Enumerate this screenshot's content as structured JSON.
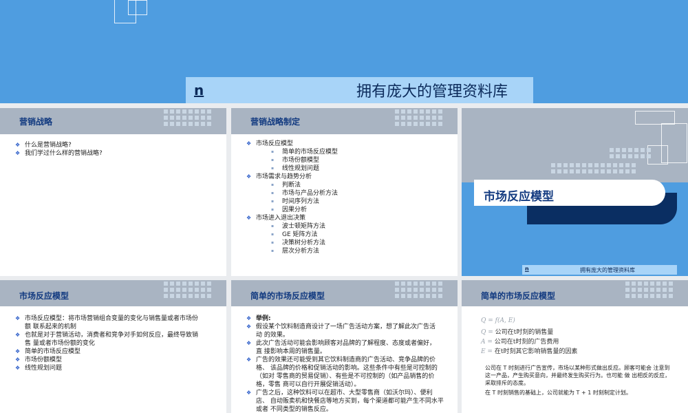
{
  "banner": {
    "marker": "n",
    "title": "拥有庞大的管理资料库"
  },
  "slide1": {
    "title": "营销战略",
    "items": [
      {
        "bullet": "❖",
        "text": "什么是营销战略?"
      },
      {
        "bullet": "❖",
        "text": "我们学过什么样的营销战略?"
      }
    ]
  },
  "slide2": {
    "title": "营销战略制定",
    "items": [
      {
        "bullet": "❖",
        "text": "市场反应模型"
      },
      {
        "bullet": "▪",
        "text": "简单的市场反应模型"
      },
      {
        "bullet": "▪",
        "text": "市场份额模型"
      },
      {
        "bullet": "▪",
        "text": "线性规划问题"
      },
      {
        "bullet": "❖",
        "text": "市场需求与趋势分析"
      },
      {
        "bullet": "▪",
        "text": "判断法"
      },
      {
        "bullet": "▪",
        "text": "市场与产品分析方法"
      },
      {
        "bullet": "▪",
        "text": "时间序列方法"
      },
      {
        "bullet": "▪",
        "text": "因果分析"
      },
      {
        "bullet": "❖",
        "text": "市场进入退出决策"
      },
      {
        "bullet": "▪",
        "text": "波士顿矩阵方法"
      },
      {
        "bullet": "▪",
        "text": "GE 矩阵方法"
      },
      {
        "bullet": "▪",
        "text": "决策树分析方法"
      },
      {
        "bullet": "▪",
        "text": "层次分析方法"
      }
    ]
  },
  "slide3": {
    "title": "市场反应模型",
    "footer_marker": "n",
    "footer_text": "拥有庞大的管理资料库"
  },
  "slide4": {
    "title": "市场反应模型",
    "items": [
      {
        "bullet": "❖",
        "text": "市场反应模型：将市场营销组合变量的变化与销售量或者市场份"
      },
      {
        "bullet": "",
        "text": "额 联系起来的机制"
      },
      {
        "bullet": "❖",
        "text": "也就是对于营销活动，消费者和竞争对手如何反应，最终导致销"
      },
      {
        "bullet": "",
        "text": "售 量或者市场份额的变化"
      },
      {
        "bullet": "❖",
        "text": "简单的市场反应模型"
      },
      {
        "bullet": "❖",
        "text": "市场份额模型"
      },
      {
        "bullet": "❖",
        "text": "线性规划问题"
      }
    ]
  },
  "slide5": {
    "title": "简单的市场反应模型",
    "items": [
      {
        "bullet": "❖",
        "text": "举例:"
      },
      {
        "bullet": "❖",
        "text": "假设某个饮料制造商设计了一场广告活动方案，想了解此次广告活"
      },
      {
        "bullet": "",
        "text": "动 的效果。"
      },
      {
        "bullet": "❖",
        "text": "此次广告活动可能会影响顾客对品牌的了解程度、态度或者偏好，"
      },
      {
        "bullet": "",
        "text": "直 接影响本周的销售量。"
      },
      {
        "bullet": "❖",
        "text": "广告的效果还可能受到其它饮料制造商的广告活动、竞争品牌的价"
      },
      {
        "bullet": "",
        "text": "格、 该品牌的价格和促销活动的影响。这些条件中有些是可控制的"
      },
      {
        "bullet": "",
        "text": "（如对 零售商的贸易促销）、有些是不可控制的（如产品销售的价"
      },
      {
        "bullet": "",
        "text": "格，零售 商可以自行开展促销活动）。"
      },
      {
        "bullet": "❖",
        "text": "广告之后，这种饮料可以在超市、大型零售商（如沃尔玛）、便利"
      },
      {
        "bullet": "",
        "text": "店、 自动贩卖机和快餐店等地方买到，每个渠道都可能产生不同水平"
      },
      {
        "bullet": "",
        "text": "或者 不同类型的销售反应。"
      }
    ]
  },
  "slide6": {
    "title": "简单的市场反应模型",
    "formulas": [
      {
        "var": "Q = f(A, E)",
        "text": ""
      },
      {
        "var": "Q =",
        "text": "公司在t时刻的销售量"
      },
      {
        "var": "A =",
        "text": "公司在t时刻的广告费用"
      },
      {
        "var": "E =",
        "text": "在t时刻其它影响销售量的因素"
      }
    ],
    "para1": "公司在 T 时刻进行广告宣传，市场以某种形式做出反应。顾客可能会 注意到这一产品，产生购买意向，并最终发生购买行为。也可能 做 出相反的反应，采取排斥的态度。",
    "para2": "在 T 时刻销售的基础上，公司就能为 T + 1 时刻制定计划。"
  }
}
